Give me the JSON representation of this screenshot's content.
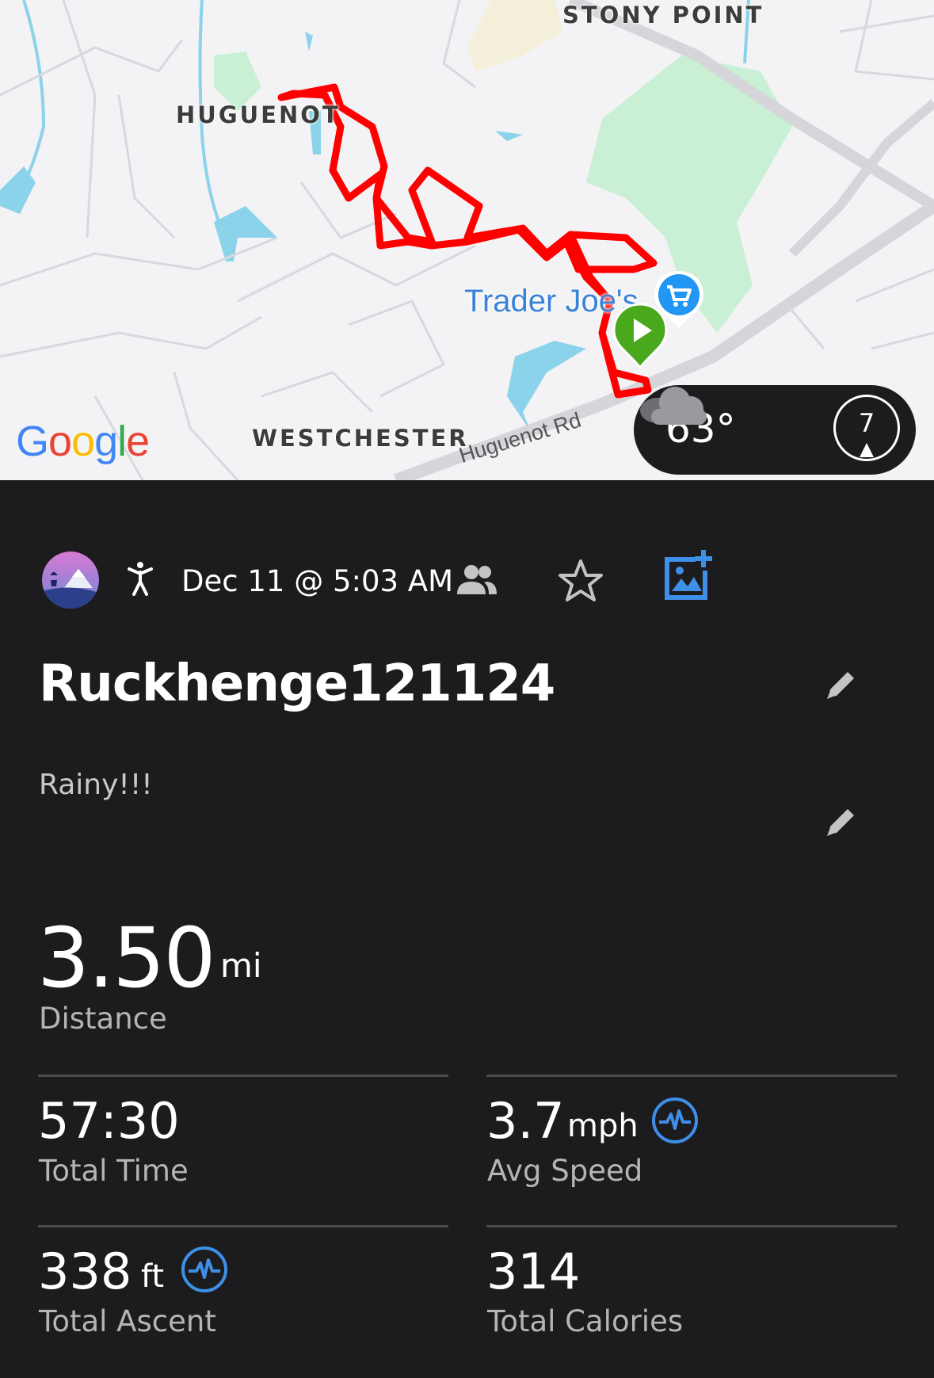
{
  "map": {
    "labels": {
      "stony_point": "STONY POINT",
      "huguenot": "HUGUENOT",
      "westchester": "WESTCHESTER",
      "road": "Huguenot Rd",
      "poi": "Trader Joe's"
    },
    "attribution": [
      "G",
      "o",
      "o",
      "g",
      "l",
      "e"
    ],
    "route_color": "#ff0000",
    "start_marker_color": "#4aa81c",
    "poi_marker_color": "#2196f3",
    "weather": {
      "temperature": "63°",
      "condition_icon": "cloud-icon",
      "wind_speed": "7"
    }
  },
  "activity": {
    "avatar_icon": "avatar",
    "type_icon": "hiking-person-icon",
    "date": "Dec 11 @ 5:03 AM",
    "people_icon": "people-icon",
    "favorite_icon": "star-icon",
    "add_photo_icon": "add-photo-icon",
    "title": "Ruckhenge121124",
    "description": "Rainy!!!"
  },
  "stats": {
    "distance": {
      "value": "3.50",
      "unit": "mi",
      "label": "Distance"
    },
    "total_time": {
      "value": "57:30",
      "label": "Total Time"
    },
    "avg_speed": {
      "value": "3.7",
      "unit": "mph",
      "label": "Avg Speed",
      "icon": "pulse-icon"
    },
    "total_ascent": {
      "value": "338",
      "unit": "ft",
      "label": "Total Ascent",
      "icon": "pulse-icon"
    },
    "total_calories": {
      "value": "314",
      "label": "Total Calories"
    }
  },
  "colors": {
    "background": "#1c1c1e",
    "accent_blue": "#3e8fe8",
    "label_gray": "#b5b5b5"
  }
}
